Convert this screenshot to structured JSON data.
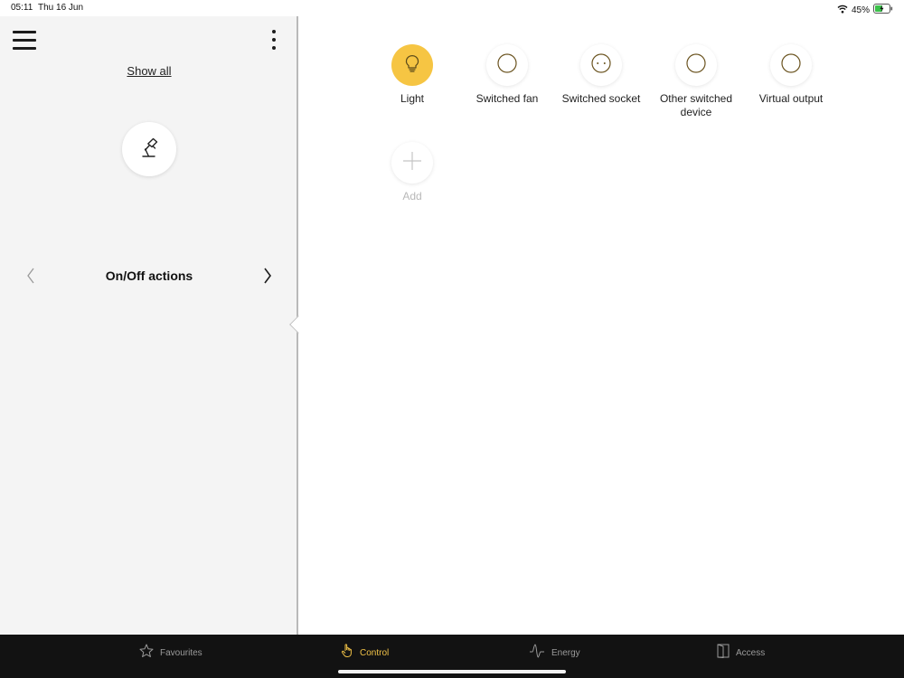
{
  "status_bar": {
    "time": "05:11",
    "date": "Thu 16 Jun",
    "battery_percent": "45%",
    "icons": [
      "wifi-icon",
      "battery-charging-icon"
    ]
  },
  "left_panel": {
    "show_all_label": "Show all",
    "selected_icon": "desk-lamp-icon",
    "action_title": "On/Off actions"
  },
  "devices": [
    {
      "label": "Light",
      "icon": "lightbulb-icon",
      "active": true
    },
    {
      "label": "Switched fan",
      "icon": "circle-icon",
      "active": false
    },
    {
      "label": "Switched socket",
      "icon": "socket-icon",
      "active": false
    },
    {
      "label": "Other switched device",
      "icon": "circle-icon",
      "active": false
    },
    {
      "label": "Virtual output",
      "icon": "circle-icon",
      "active": false
    }
  ],
  "add_label": "Add",
  "tabs": [
    {
      "label": "Favourites",
      "icon": "star-icon",
      "active": false
    },
    {
      "label": "Control",
      "icon": "hand-pointer-icon",
      "active": true
    },
    {
      "label": "Energy",
      "icon": "energy-wave-icon",
      "active": false
    },
    {
      "label": "Access",
      "icon": "door-icon",
      "active": false
    }
  ],
  "colors": {
    "accent": "#f6c543",
    "tab_active": "#f1c247",
    "bottom_bar": "#121212",
    "left_panel_bg": "#f4f4f4"
  }
}
